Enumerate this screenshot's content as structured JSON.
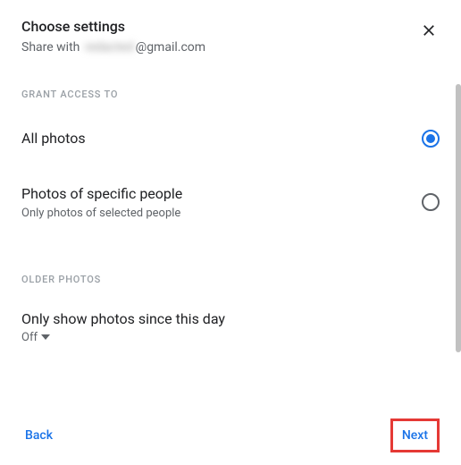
{
  "header": {
    "title": "Choose settings",
    "share_prefix": "Share with ",
    "share_blurred": "redacted",
    "share_suffix": "@gmail.com"
  },
  "sections": {
    "grant_access": {
      "label": "GRANT ACCESS TO",
      "options": [
        {
          "title": "All photos",
          "desc": "",
          "selected": true
        },
        {
          "title": "Photos of specific people",
          "desc": "Only photos of selected people",
          "selected": false
        }
      ]
    },
    "older_photos": {
      "label": "OLDER PHOTOS",
      "title": "Only show photos since this day",
      "value": "Off"
    }
  },
  "footer": {
    "back": "Back",
    "next": "Next"
  }
}
